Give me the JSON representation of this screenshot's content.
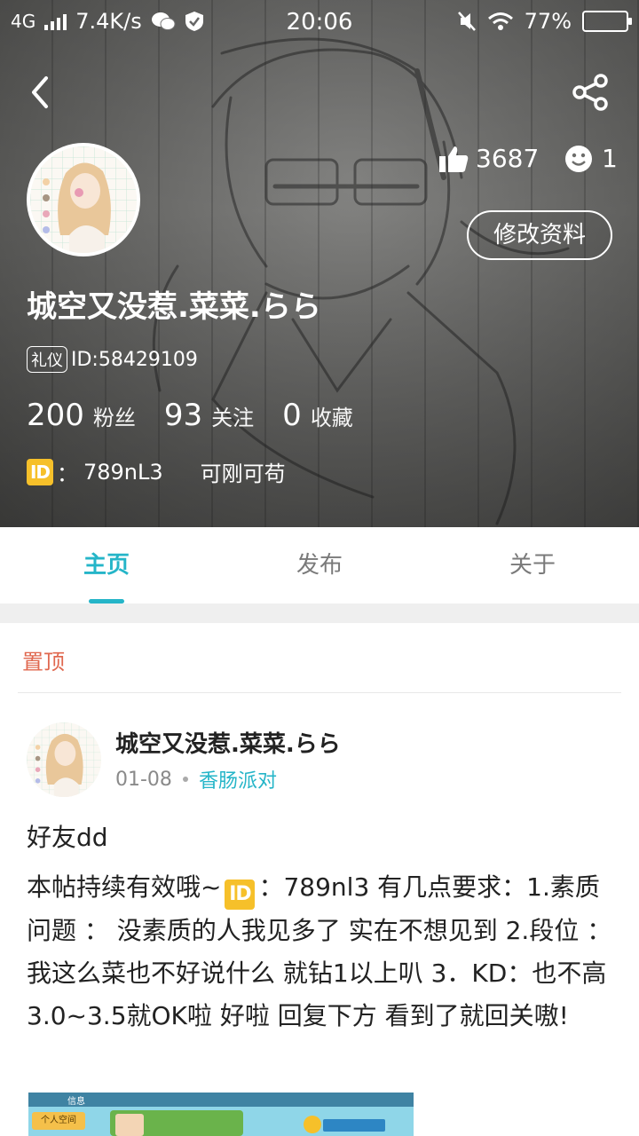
{
  "status_bar": {
    "network": "4G",
    "speed": "7.4K/s",
    "time": "20:06",
    "battery": "77%",
    "battery_level": 0.77
  },
  "profile": {
    "likes": "3687",
    "visitors": "1",
    "edit_label": "修改资料",
    "nickname": "城空又没惹.菜菜.らら",
    "tag": "礼仪",
    "user_id": "ID:58429109",
    "stats": {
      "fans_count": "200",
      "fans_label": "粉丝",
      "follow_count": "93",
      "follow_label": "关注",
      "fav_count": "0",
      "fav_label": "收藏"
    },
    "game_badge": "ID",
    "game_sep": "：",
    "game_id": "789nL3",
    "game_extra": "可刚可苟"
  },
  "tabs": [
    "主页",
    "发布",
    "关于"
  ],
  "active_tab": 0,
  "post": {
    "pinned_label": "置顶",
    "author": "城空又没惹.菜菜.らら",
    "date": "01-08",
    "topic": "香肠派对",
    "title": "好友dd",
    "body_before_badge": "本帖持续有效哦~",
    "body_badge": "ID",
    "body_after_badge": "：789nl3 有几点要求：1.素质问题 ： 没素质的人我见多了 实在不想见到 2.段位 ： 我这么菜也不好说什么 就钻1以上叭 3．KD：也不高 3.0~3.5就OK啦 好啦 回复下方 看到了就回关嗷!",
    "image_caption": "信息",
    "image_button": "个人空间"
  },
  "colors": {
    "accent": "#25b5c8",
    "pinned": "#e0684f",
    "id_badge": "#f6c02a"
  }
}
